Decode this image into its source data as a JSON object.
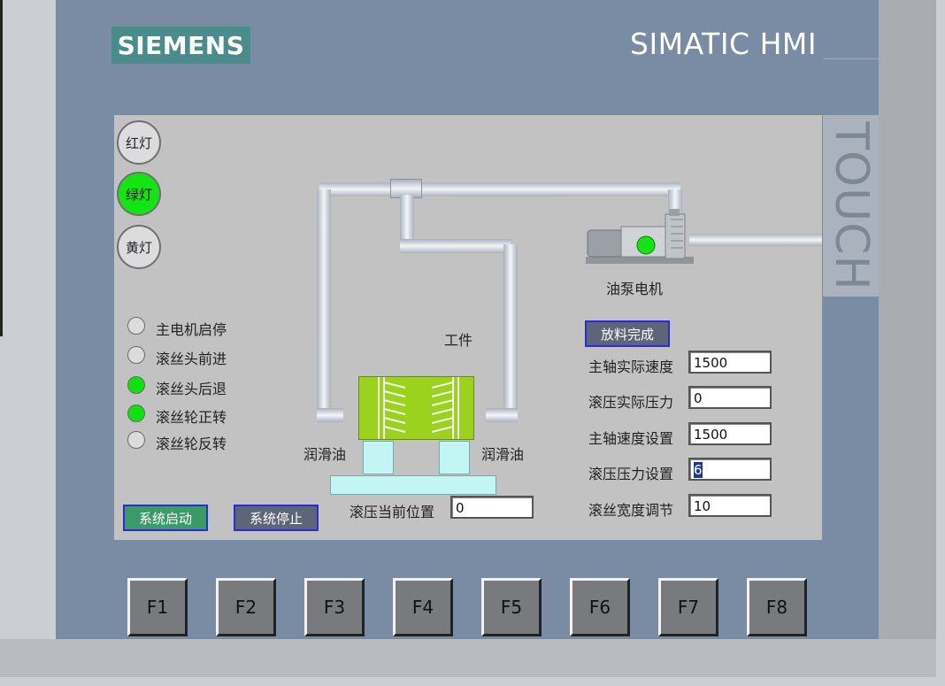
{
  "header": {
    "logo": "SIEMENS",
    "brand": "SIMATIC HMI",
    "touch": "TOUCH"
  },
  "lamps": [
    {
      "label": "红灯",
      "on": false
    },
    {
      "label": "绿灯",
      "on": true
    },
    {
      "label": "黄灯",
      "on": false
    }
  ],
  "indicators": [
    {
      "label": "主电机启停",
      "on": false
    },
    {
      "label": "滚丝头前进",
      "on": false
    },
    {
      "label": "滚丝头后退",
      "on": true
    },
    {
      "label": "滚丝轮正转",
      "on": true
    },
    {
      "label": "滚丝轮反转",
      "on": false
    }
  ],
  "diagram": {
    "workpiece_label": "工件",
    "lube_left": "润滑油",
    "lube_right": "润滑油",
    "motor_label": "油泵电机",
    "position_label": "滚压当前位置",
    "position_value": "0"
  },
  "buttons": {
    "start": "系统启动",
    "stop": "系统停止",
    "discharge": "放料完成"
  },
  "params": [
    {
      "label": "主轴实际速度",
      "value": "1500"
    },
    {
      "label": "滚压实际压力",
      "value": "0"
    },
    {
      "label": "主轴速度设置",
      "value": "1500"
    },
    {
      "label": "滚压压力设置",
      "value": "6"
    },
    {
      "label": "滚丝宽度调节",
      "value": "10"
    }
  ],
  "fkeys": [
    "F1",
    "F2",
    "F3",
    "F4",
    "F5",
    "F6",
    "F7",
    "F8"
  ],
  "colors": {
    "lamp_on": "#13e413",
    "bezel": "#7a8ca3",
    "logo_bg": "#4a8b8c",
    "workpiece": "#9ad21d"
  }
}
